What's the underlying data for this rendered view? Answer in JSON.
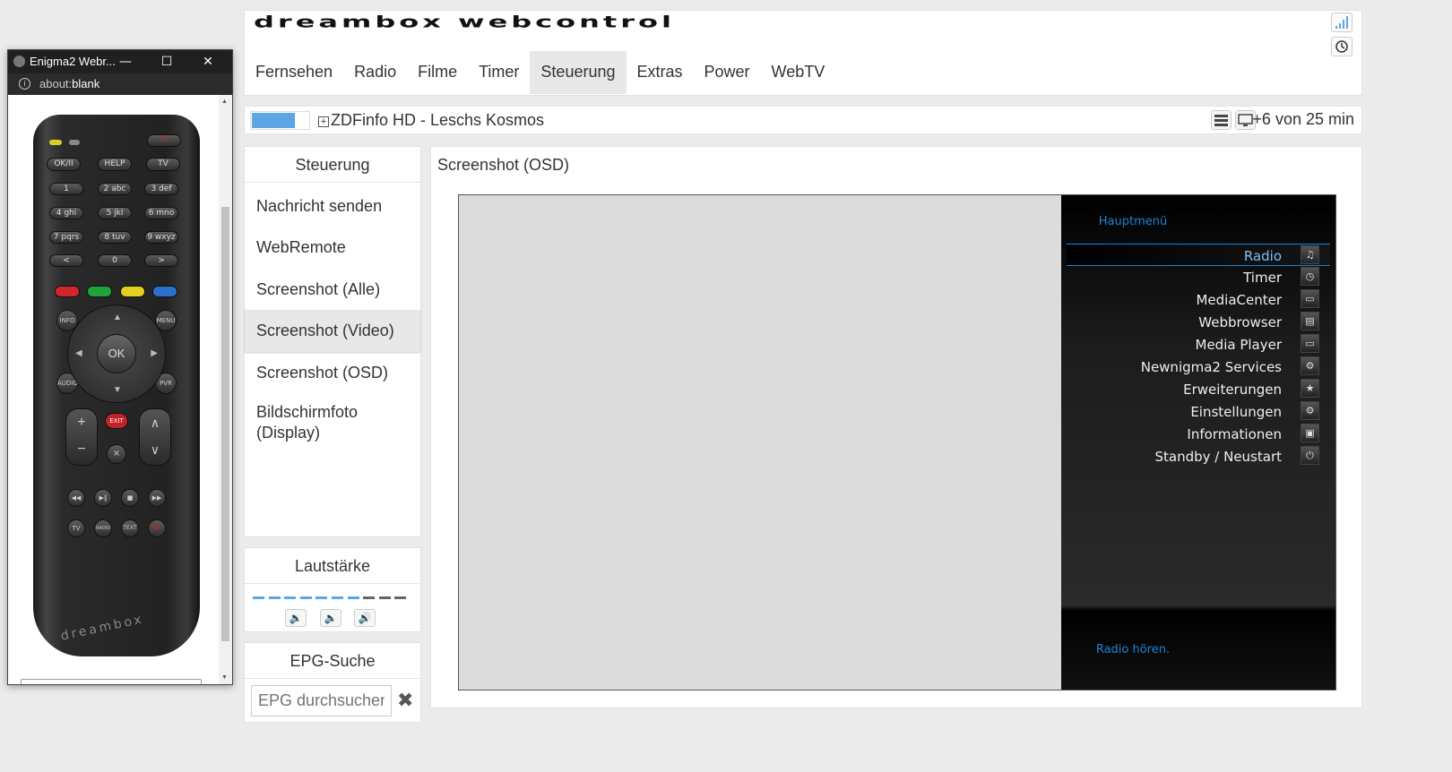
{
  "popup": {
    "title": "Enigma2 Webr...",
    "url_scheme": "about:",
    "url_path": "blank",
    "minimize_glyph": "—",
    "maximize_glyph": "☐",
    "close_glyph": "✕",
    "remote": {
      "digits": [
        "1",
        "2 abc",
        "3 def",
        "4 ghi",
        "5 jkl",
        "6 mno",
        "7 pqrs",
        "8 tuv",
        "9 wxyz",
        "<",
        "0",
        ">"
      ],
      "top_keys": [
        "OK/II",
        "HELP",
        "TV"
      ],
      "side_keys": [
        "INFO",
        "MENU",
        "AUDIO",
        "PVR"
      ],
      "ok_label": "OK",
      "exit_label": "EXIT",
      "bottom_keys": [
        "TV",
        "RADIO",
        "TEXT",
        "REC"
      ],
      "brand": "dreambox",
      "colors": [
        "#d3232b",
        "#1fa33a",
        "#e4cf1e",
        "#2a6fcb"
      ]
    }
  },
  "header": {
    "logo": "dreambox webcontrol",
    "nav": [
      "Fernsehen",
      "Radio",
      "Filme",
      "Timer",
      "Steuerung",
      "Extras",
      "Power",
      "WebTV"
    ],
    "active_nav": "Steuerung"
  },
  "status": {
    "channel": "ZDFinfo HD - Leschs Kosmos",
    "remaining": "+6 von 25 min",
    "progress": 0.76,
    "progress_color": "#5ca6e6"
  },
  "sidebar": {
    "title": "Steuerung",
    "items": [
      "Nachricht senden",
      "WebRemote",
      "Screenshot (Alle)",
      "Screenshot (Video)",
      "Screenshot (OSD)",
      "Bildschirmfoto (Display)"
    ],
    "active_item": "Screenshot (Video)"
  },
  "volume": {
    "title": "Lautstärke",
    "level": 7,
    "max": 10,
    "active_color": "#5ca6e6",
    "inactive_color": "#666666"
  },
  "epg": {
    "title": "EPG-Suche",
    "placeholder": "EPG durchsuchen"
  },
  "main": {
    "title": "Screenshot (OSD)",
    "osd_menu": {
      "title": "Hauptmenü",
      "items": [
        "Radio",
        "Timer",
        "MediaCenter",
        "Webbrowser",
        "Media Player",
        "Newnigma2 Services",
        "Erweiterungen",
        "Einstellungen",
        "Informationen",
        "Standby / Neustart"
      ],
      "selected": "Radio",
      "footer": "Radio hören.",
      "accent_color": "#1b83d6"
    }
  }
}
